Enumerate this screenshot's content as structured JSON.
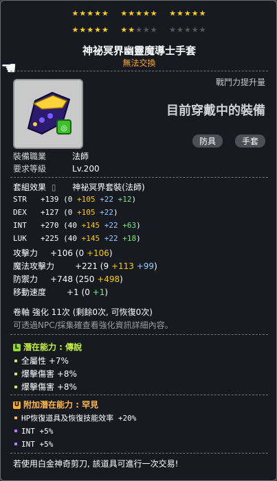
{
  "item": {
    "name": "神祕冥界幽靈魔導士手套",
    "trade_status": "無法交換",
    "combat_power_label": "戰鬥力提升量",
    "equipped_text": "目前穿戴中的裝備",
    "tags": [
      "防具",
      "手套"
    ],
    "star_force": {
      "current": 17,
      "max": 25
    }
  },
  "requirements": {
    "job_label": "裝備職業",
    "job_value": "法師",
    "level_label": "要求等級",
    "level_value": "Lv.200"
  },
  "set_effect": {
    "label": "套組效果",
    "name": "神祕冥界套裝(法師)"
  },
  "stats": [
    {
      "name": "STR",
      "total": "+139",
      "base": "0",
      "flame": "+105",
      "scroll": "+22",
      "star": "+12"
    },
    {
      "name": "DEX",
      "total": "+127",
      "base": "0",
      "flame": "+105",
      "scroll": "+22"
    },
    {
      "name": "INT",
      "total": "+270",
      "base": "40",
      "flame": "+145",
      "scroll": "+22",
      "star": "+63"
    },
    {
      "name": "LUK",
      "total": "+225",
      "base": "40",
      "flame": "+145",
      "scroll": "+22",
      "star": "+18"
    },
    {
      "name": "攻擊力",
      "total": "+106",
      "base": "0",
      "flame": "+106"
    },
    {
      "name": "魔法攻擊力",
      "total": "+221",
      "base": "9",
      "flame": "+113",
      "scroll": "+99"
    },
    {
      "name": "防禦力",
      "total": "+748",
      "base": "250",
      "flame": "+498"
    },
    {
      "name": "移動速度",
      "total": "+1",
      "base": "0",
      "star": "+1"
    }
  ],
  "upgrade": {
    "line": "卷軸 強化 11次 (剩餘0次, 可恢復0次)",
    "hint": "可透過NPC/採集確查看強化資訊詳細內容。"
  },
  "potential": {
    "header": "潛在能力 : 傳說",
    "lines": [
      "全屬性 +7%",
      "爆擊傷害 +8%",
      "爆擊傷害 +8%"
    ]
  },
  "additional_potential": {
    "header": "附加潛在能力 : 罕見",
    "lines": [
      "HP恢復道具及恢復技能效率 +20%",
      "INT +5%",
      "INT +5%"
    ]
  },
  "footer": "若使用白金神奇剪刀, 該道具可進行一次交易!",
  "colors": {
    "legendary": "#c6f23a",
    "unique": "#ffb84a",
    "flame": "#ffcc00",
    "scroll": "#99ccff",
    "starforce": "#77ee77",
    "trade_status": "#ffa726"
  }
}
